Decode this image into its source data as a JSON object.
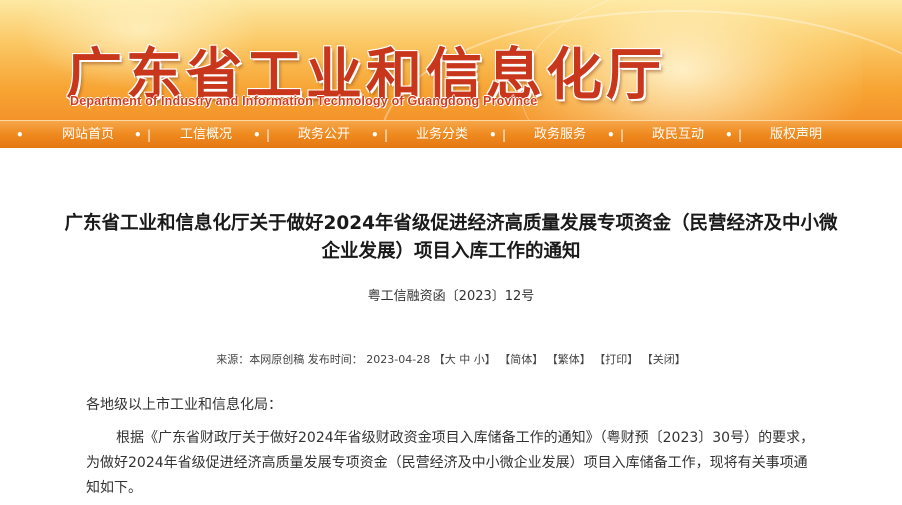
{
  "header": {
    "title": "广东省工业和信息化厅",
    "subtitle": "Department of Industry and Information Technology of Guangdong Province"
  },
  "nav": {
    "items": [
      {
        "label": "网站首页"
      },
      {
        "label": "工信概况"
      },
      {
        "label": "政务公开"
      },
      {
        "label": "业务分类"
      },
      {
        "label": "政务服务"
      },
      {
        "label": "政民互动"
      },
      {
        "label": "版权声明"
      }
    ],
    "separator": "|",
    "bullet": "•"
  },
  "article": {
    "title": "广东省工业和信息化厅关于做好2024年省级促进经济高质量发展专项资金（民营经济及中小微企业发展）项目入库工作的通知",
    "doc_number": "粤工信融资函〔2023〕12号",
    "meta": {
      "source_label": "来源：",
      "source_value": "本网原创稿",
      "date_label": "发布时间：",
      "date_value": "2023-04-28",
      "font_open": "【",
      "font_large": "大",
      "font_medium": "中",
      "font_small": "小",
      "font_close": "】",
      "simplified": "【简体】",
      "traditional": "【繁体】",
      "print": "【打印】",
      "close": "【关闭】"
    },
    "salutation": "各地级以上市工业和信息化局：",
    "paragraph": "根据《广东省财政厅关于做好2024年省级财政资金项目入库储备工作的通知》（粤财预〔2023〕30号）的要求，为做好2024年省级促进经济高质量发展专项资金（民营经济及中小微企业发展）项目入库储备工作，现将有关事项通知如下。"
  },
  "colors": {
    "title_red": "#c8371c",
    "nav_orange": "#ef8a1e",
    "banner_light": "#fde9a4"
  }
}
